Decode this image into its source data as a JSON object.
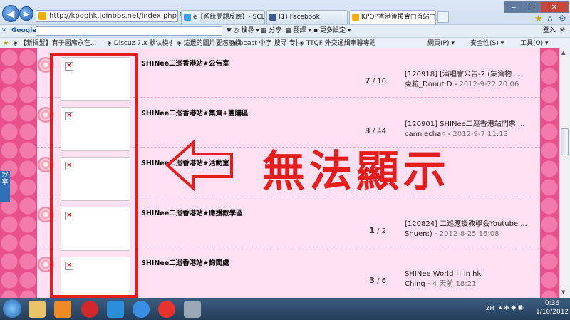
{
  "browser": {
    "url": "http://kpophk.joinbbs.net/index.php",
    "tabs": [
      {
        "label": "e【系統問題反應】- SCLUB免...",
        "color": "#3aa0e8"
      },
      {
        "label": "(1) Facebook",
        "color": "#3b5998"
      },
      {
        "label": "KPOP香港後援會□首站□|K...",
        "color": "#f0b000",
        "active": true
      }
    ],
    "google": {
      "logo": "Google",
      "search_label": "搜尋",
      "share_label": "分享",
      "translate_label": "翻譯",
      "more_label": "更多設定",
      "login_label": "登入"
    },
    "favorites": [
      "【新揭髮】有子固席永在...",
      "Discuz-7.x 默认模板 解说 ...",
      "這邊的圖片要怎麼樣才能...",
      "beast 中字 搜寻-专技视频",
      "TTQF 外交通緝串聯專貼 -..."
    ],
    "toolbar_right": [
      "網頁(P)",
      "安全性(S)",
      "工具(O)"
    ]
  },
  "forum": {
    "rows": [
      {
        "title": "SHINee二巡香港站★公告室",
        "topics": "7",
        "posts": "10",
        "last_title": "[120918] [演唱會公告-2 (集資物 ...",
        "last_user": "東粒_Donut:D",
        "last_date": "2012-9-22 20:06"
      },
      {
        "title": "SHINee二巡香港站★集資+團購區",
        "topics": "3",
        "posts": "44",
        "last_title": "[120901] SHINee二巡香港站門票 ...",
        "last_user": "canniechan",
        "last_date": "2012-9-7 11:13"
      },
      {
        "title": "SHINee二巡香港站★活動室",
        "topics": "",
        "posts": "",
        "last_title": "",
        "last_user": "",
        "last_date": ""
      },
      {
        "title": "SHINee二巡香港站★應援教學區",
        "topics": "1",
        "posts": "2",
        "last_title": "[120824] 二巡應援教學会Youtube ...",
        "last_user": "Shuen:)",
        "last_date": "2012-8-25 16:08"
      },
      {
        "title": "SHINee二巡香港站★詢問處",
        "topics": "3",
        "posts": "6",
        "last_title": "SHINee World !! in hk",
        "last_user": "Ching",
        "last_date": "4 天前 18:21"
      }
    ]
  },
  "share_button": "分享",
  "annotation": {
    "text": "無法顯示",
    "color": "#e41d1d"
  },
  "taskbar": {
    "time": "0:36",
    "date": "1/10/2012",
    "lang": "ZH"
  }
}
